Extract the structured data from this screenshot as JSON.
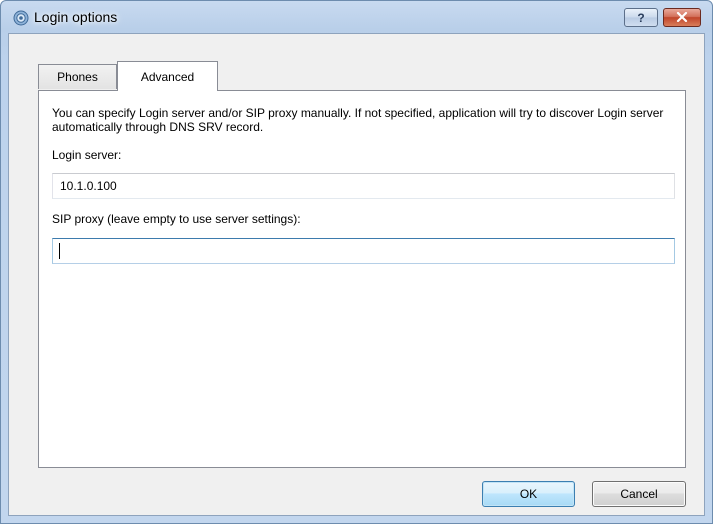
{
  "window": {
    "title": "Login options",
    "help_label": "?",
    "accent": "#3c7fb1"
  },
  "tabs": [
    {
      "label": "Phones",
      "selected": false
    },
    {
      "label": "Advanced",
      "selected": true
    }
  ],
  "advanced": {
    "description": "You can specify Login server and/or SIP proxy manually. If not specified, application will try to discover Login server automatically through DNS SRV record.",
    "login_server_label": "Login server:",
    "login_server_value": "10.1.0.100",
    "sip_proxy_label": "SIP proxy (leave empty to use server settings):",
    "sip_proxy_value": ""
  },
  "buttons": {
    "ok": "OK",
    "cancel": "Cancel"
  },
  "icons": {
    "title": "gear-icon",
    "close": "close-icon"
  }
}
